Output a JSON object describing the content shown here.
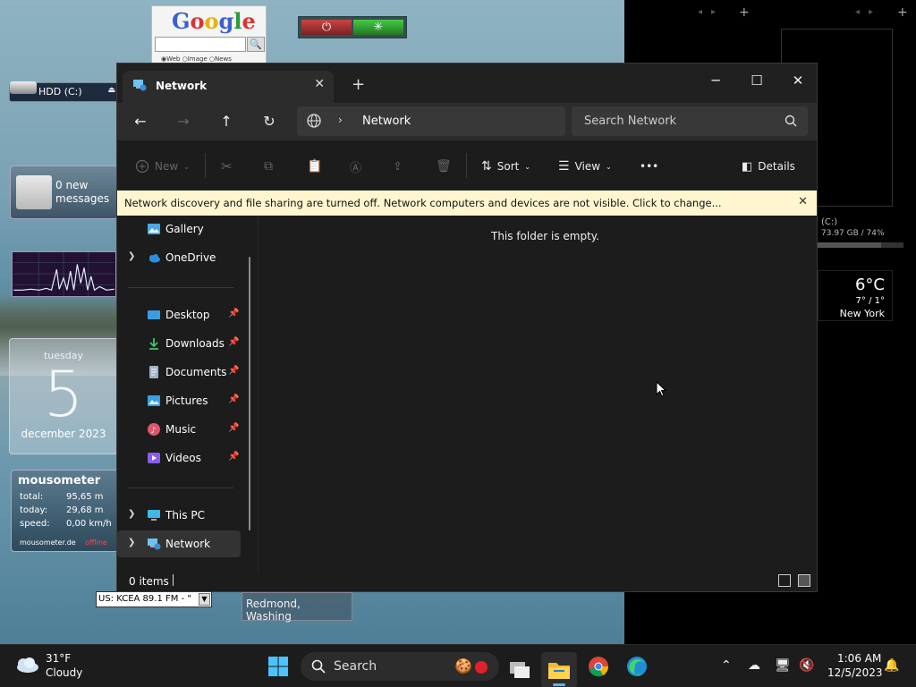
{
  "desktop": {
    "google": {
      "logo": "Google",
      "search_button": "🔍",
      "radios": "◉Web ○Image ○News"
    },
    "hdd": {
      "label": "HDD (C:)"
    },
    "mail": {
      "line1": "0 new",
      "line2": "messages"
    },
    "calendar": {
      "weekday": "tuesday",
      "day": "5",
      "month": "december 2023"
    },
    "mousometer": {
      "title": "mousometer",
      "rows": [
        {
          "label": "total:",
          "value": "95,65 m"
        },
        {
          "label": "today:",
          "value": "29,68 m"
        },
        {
          "label": "speed:",
          "value": "0,00 km/h"
        }
      ],
      "footer": "mousometer.de",
      "status": "offline"
    },
    "radio": {
      "station": "US: KCEA 89.1 FM - \""
    },
    "location": {
      "text": "Redmond, Washing"
    },
    "right_panel": {
      "drive": "(C:)",
      "drive_usage": "73.97 GB / 74%",
      "drive_fraction": 0.74,
      "temp": "6°C",
      "range": "7° / 1°",
      "city": "New York"
    }
  },
  "window": {
    "tab_title": "Network",
    "controls": {
      "minimize": "─",
      "maximize": "☐",
      "close": "✕"
    },
    "address": {
      "crumb": "Network"
    },
    "search_placeholder": "Search Network",
    "toolbar": {
      "new": "New",
      "sort": "Sort",
      "view": "View",
      "more": "•••",
      "details": "Details"
    },
    "infobar": {
      "text": "Network discovery and file sharing are turned off. Network computers and devices are not visible. Click to change..."
    },
    "nav": {
      "gallery": "Gallery",
      "onedrive": "OneDrive",
      "desktop": "Desktop",
      "downloads": "Downloads",
      "documents": "Documents",
      "pictures": "Pictures",
      "music": "Music",
      "videos": "Videos",
      "thispc": "This PC",
      "network": "Network"
    },
    "empty_message": "This folder is empty.",
    "status": {
      "count": "0 items"
    }
  },
  "taskbar": {
    "weather_temp": "31°F",
    "weather_condition": "Cloudy",
    "search_label": "Search",
    "time": "1:06 AM",
    "date": "12/5/2023"
  }
}
